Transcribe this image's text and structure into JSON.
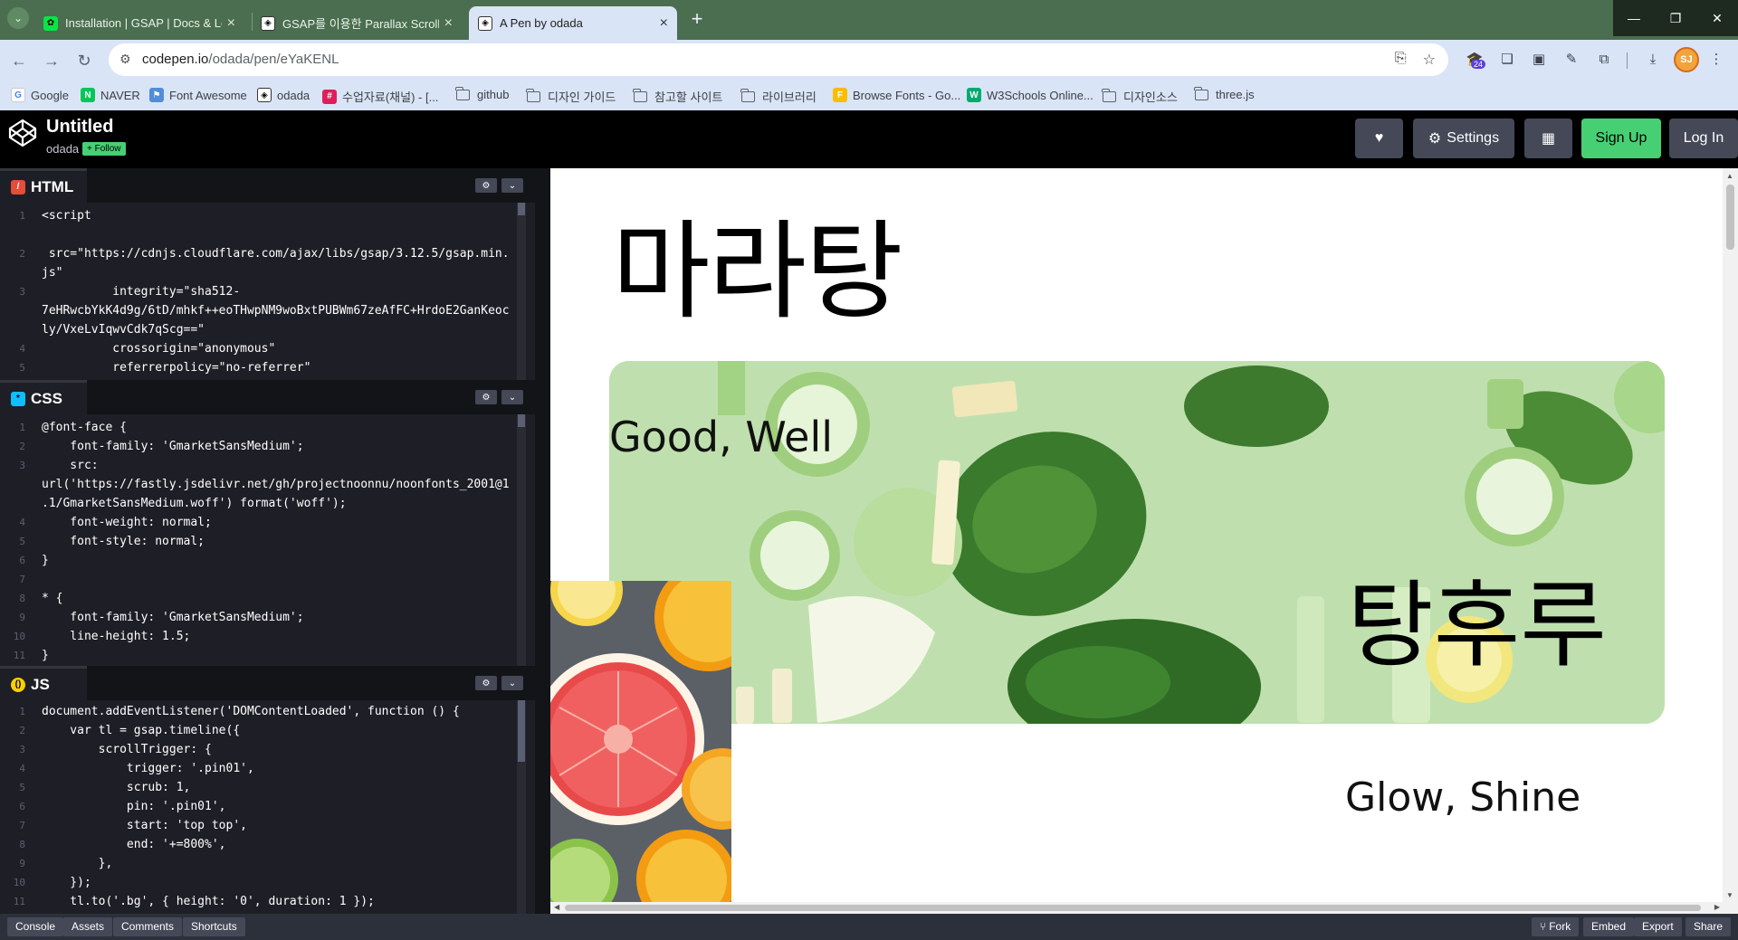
{
  "browser": {
    "tabs": [
      {
        "label": "Installation | GSAP | Docs & Le",
        "active": false
      },
      {
        "label": "GSAP를 이용한 Parallax Scrolli",
        "active": false
      },
      {
        "label": "A Pen by odada",
        "active": true
      }
    ],
    "url_host": "codepen.io",
    "url_path": "/odada/pen/eYaKENL",
    "ext_badge": "24",
    "avatar_initials": "SJ",
    "bookmarks": [
      {
        "label": "Google",
        "kind": "site",
        "icon": "google-icon"
      },
      {
        "label": "NAVER",
        "kind": "site",
        "icon": "naver-icon"
      },
      {
        "label": "Font Awesome",
        "kind": "site",
        "icon": "flag-icon"
      },
      {
        "label": "odada",
        "kind": "site",
        "icon": "codepen-icon"
      },
      {
        "label": "수업자료(채널) - [...",
        "kind": "site",
        "icon": "slack-icon"
      },
      {
        "label": "github",
        "kind": "folder",
        "icon": "folder-icon"
      },
      {
        "label": "디자인 가이드",
        "kind": "folder",
        "icon": "folder-icon"
      },
      {
        "label": "참고할 사이트",
        "kind": "folder",
        "icon": "folder-icon"
      },
      {
        "label": "라이브러리",
        "kind": "folder",
        "icon": "folder-icon"
      },
      {
        "label": "Browse Fonts - Go...",
        "kind": "site",
        "icon": "google-fonts-icon"
      },
      {
        "label": "W3Schools Online...",
        "kind": "site",
        "icon": "w3schools-icon"
      },
      {
        "label": "디자인소스",
        "kind": "folder",
        "icon": "folder-icon"
      },
      {
        "label": "three.js",
        "kind": "folder",
        "icon": "folder-icon"
      }
    ]
  },
  "codepen": {
    "title": "Untitled",
    "user": "odada",
    "follow": "+ Follow",
    "settings": "Settings",
    "signup": "Sign Up",
    "login": "Log In"
  },
  "editors": {
    "html": {
      "label": "HTML",
      "lines": [
        {
          "n": "1",
          "t": "<script"
        },
        {
          "n": "",
          "t": ""
        },
        {
          "n": "2",
          "t": " src=\"https://cdnjs.cloudflare.com/ajax/libs/gsap/3.12.5/gsap.min."
        },
        {
          "n": "",
          "t": "js\""
        },
        {
          "n": "3",
          "t": "          integrity=\"sha512-"
        },
        {
          "n": "",
          "t": "7eHRwcbYkK4d9g/6tD/mhkf++eoTHwpNM9woBxtPUBWm67zeAfFC+HrdoE2GanKeoc"
        },
        {
          "n": "",
          "t": "ly/VxeLvIqwvCdk7qScg==\""
        },
        {
          "n": "4",
          "t": "          crossorigin=\"anonymous\""
        },
        {
          "n": "5",
          "t": "          referrerpolicy=\"no-referrer\""
        }
      ]
    },
    "css": {
      "label": "CSS",
      "lines": [
        {
          "n": "1",
          "t": "@font-face {"
        },
        {
          "n": "2",
          "t": "    font-family: 'GmarketSansMedium';"
        },
        {
          "n": "3",
          "t": "    src:"
        },
        {
          "n": "",
          "t": "url('https://fastly.jsdelivr.net/gh/projectnoonnu/noonfonts_2001@1"
        },
        {
          "n": "",
          "t": ".1/GmarketSansMedium.woff') format('woff');"
        },
        {
          "n": "4",
          "t": "    font-weight: normal;"
        },
        {
          "n": "5",
          "t": "    font-style: normal;"
        },
        {
          "n": "6",
          "t": "}"
        },
        {
          "n": "7",
          "t": ""
        },
        {
          "n": "8",
          "t": "* {"
        },
        {
          "n": "9",
          "t": "    font-family: 'GmarketSansMedium';"
        },
        {
          "n": "10",
          "t": "    line-height: 1.5;"
        },
        {
          "n": "11",
          "t": "}"
        }
      ]
    },
    "js": {
      "label": "JS",
      "lines": [
        {
          "n": "1",
          "t": "document.addEventListener('DOMContentLoaded', function () {"
        },
        {
          "n": "2",
          "t": "    var tl = gsap.timeline({"
        },
        {
          "n": "3",
          "t": "        scrollTrigger: {"
        },
        {
          "n": "4",
          "t": "            trigger: '.pin01',"
        },
        {
          "n": "5",
          "t": "            scrub: 1,"
        },
        {
          "n": "6",
          "t": "            pin: '.pin01',"
        },
        {
          "n": "7",
          "t": "            start: 'top top',"
        },
        {
          "n": "8",
          "t": "            end: '+=800%',"
        },
        {
          "n": "9",
          "t": "        },"
        },
        {
          "n": "10",
          "t": "    });"
        },
        {
          "n": "11",
          "t": "    tl.to('.bg', { height: '0', duration: 1 });"
        }
      ]
    }
  },
  "preview": {
    "heading": "마라탕",
    "good": "Good, Well",
    "tanghuru": "탕후루",
    "glow": "Glow, Shine"
  },
  "footer": {
    "left": [
      "Console",
      "Assets",
      "Comments",
      "Shortcuts"
    ],
    "right": [
      "Fork",
      "Embed",
      "Export",
      "Share"
    ]
  },
  "colors": {
    "codepen_green": "#47cf73",
    "tab_bar": "#4a6e4f",
    "chrome_toolbar": "#d9e4f7"
  }
}
